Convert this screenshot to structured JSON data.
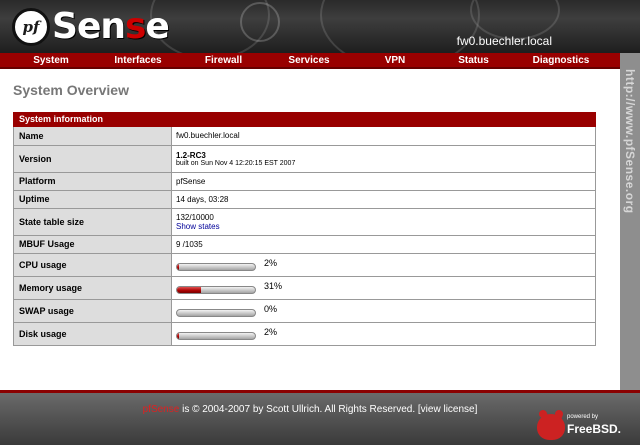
{
  "header": {
    "logo_prefix": "pf",
    "logo_text_1": "S",
    "logo_text_2": "en",
    "logo_text_3": "s",
    "logo_text_4": "e",
    "hostname": "fw0.buechler.local"
  },
  "nav": {
    "items": [
      {
        "label": "System"
      },
      {
        "label": "Interfaces"
      },
      {
        "label": "Firewall"
      },
      {
        "label": "Services"
      },
      {
        "label": "VPN"
      },
      {
        "label": "Status"
      },
      {
        "label": "Diagnostics"
      }
    ]
  },
  "sidebar": {
    "url": "http://www.pfSense.org"
  },
  "page": {
    "title": "System Overview"
  },
  "panel": {
    "title": "System information",
    "rows": {
      "name": {
        "label": "Name",
        "value": "fw0.buechler.local"
      },
      "version": {
        "label": "Version",
        "value": "1.2-RC3",
        "sub": "built on Sun Nov 4 12:20:15 EST 2007"
      },
      "platform": {
        "label": "Platform",
        "value": "pfSense"
      },
      "uptime": {
        "label": "Uptime",
        "value": "14 days, 03:28"
      },
      "state_table": {
        "label": "State table size",
        "value": "132/10000",
        "link": "Show states"
      },
      "mbuf": {
        "label": "MBUF Usage",
        "value": "9 /1035"
      },
      "cpu": {
        "label": "CPU usage",
        "percent_text": "2%",
        "percent": 2
      },
      "memory": {
        "label": "Memory usage",
        "percent_text": "31%",
        "percent": 31
      },
      "swap": {
        "label": "SWAP usage",
        "percent_text": "0%",
        "percent": 0
      },
      "disk": {
        "label": "Disk usage",
        "percent_text": "2%",
        "percent": 2
      }
    }
  },
  "footer": {
    "brand": "pfSense",
    "text": " is © 2004-2007 by Scott Ullrich. All Rights Reserved. ",
    "license_link": "[view license]",
    "powered_by": "powered by",
    "os_name": "FreeBSD."
  },
  "colors": {
    "accent": "#990000",
    "label_bg": "#dddddd",
    "bar_fill": "#aa0000"
  }
}
